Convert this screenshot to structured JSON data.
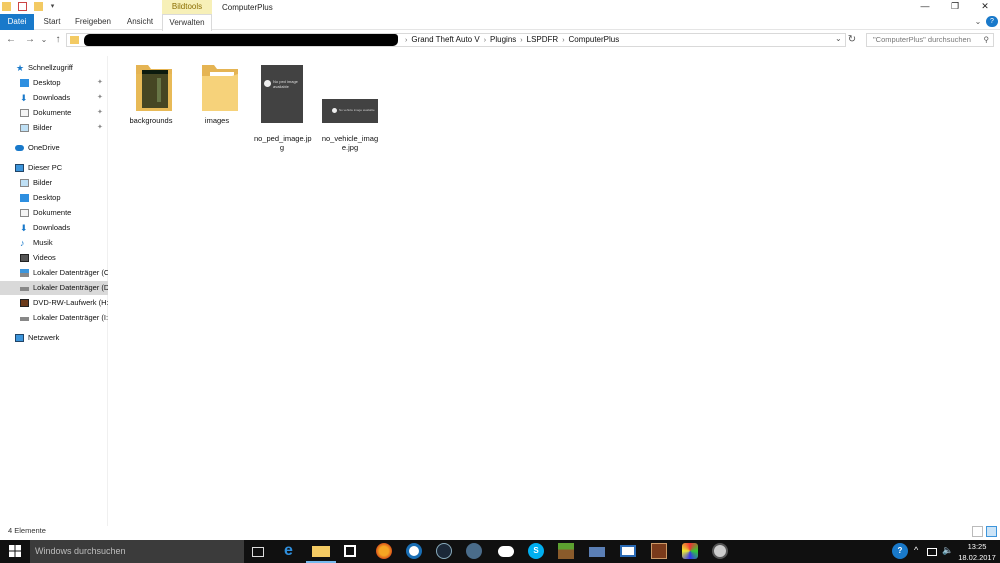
{
  "window": {
    "title": "ComputerPlus",
    "context_group": "Bildtools",
    "controls": {
      "minimize": "—",
      "maximize": "❐",
      "close": "✕"
    }
  },
  "ribbon": {
    "tabs": [
      "Datei",
      "Start",
      "Freigeben",
      "Ansicht",
      "Verwalten"
    ],
    "expand_glyph": "⌄",
    "help_glyph": "?"
  },
  "address": {
    "breadcrumbs": [
      "Grand Theft Auto V",
      "Plugins",
      "LSPDFR",
      "ComputerPlus"
    ],
    "separator": "›",
    "search_placeholder": "\"ComputerPlus\" durchsuchen",
    "nav_glyphs": {
      "back": "←",
      "forward": "→",
      "recent": "⌄",
      "up": "↑",
      "dropdown": "⌄",
      "refresh": "↻",
      "search": "⚲"
    }
  },
  "sidebar": {
    "pin_glyph": "✦",
    "items": [
      {
        "label": "Schnellzugriff",
        "icon": "star-icon"
      },
      {
        "label": "Desktop",
        "icon": "desktop-icon"
      },
      {
        "label": "Downloads",
        "icon": "download-icon"
      },
      {
        "label": "Dokumente",
        "icon": "documents-icon"
      },
      {
        "label": "Bilder",
        "icon": "pictures-icon"
      },
      {
        "label": "OneDrive",
        "icon": "cloud-icon"
      },
      {
        "label": "Dieser PC",
        "icon": "computer-icon"
      },
      {
        "label": "Bilder",
        "icon": "pictures-icon"
      },
      {
        "label": "Desktop",
        "icon": "desktop-icon"
      },
      {
        "label": "Dokumente",
        "icon": "documents-icon"
      },
      {
        "label": "Downloads",
        "icon": "download-icon"
      },
      {
        "label": "Musik",
        "icon": "music-icon"
      },
      {
        "label": "Videos",
        "icon": "video-icon"
      },
      {
        "label": "Lokaler Datenträger (C",
        "icon": "drive-icon"
      },
      {
        "label": "Lokaler Datenträger (D",
        "icon": "drive-icon"
      },
      {
        "label": "DVD-RW-Laufwerk (H:",
        "icon": "dvd-icon"
      },
      {
        "label": "Lokaler Datenträger (I:",
        "icon": "drive-icon"
      },
      {
        "label": "Netzwerk",
        "icon": "network-icon"
      }
    ]
  },
  "files": [
    {
      "name": "backgrounds",
      "type": "folder"
    },
    {
      "name": "images",
      "type": "folder"
    },
    {
      "name": "no_ped_image.jp\ng",
      "type": "image",
      "preview_text": "No ped image\navailable"
    },
    {
      "name": "no_vehicle_imag\ne.jpg",
      "type": "image",
      "preview_text": "No vehicle image available"
    }
  ],
  "status": {
    "count": "4 Elemente"
  },
  "taskbar": {
    "search_placeholder": "Windows durchsuchen",
    "apps": [
      "task-view-icon",
      "edge-icon",
      "file-explorer-icon",
      "store-icon",
      "firefox-icon",
      "teamviewer-icon",
      "steam-icon",
      "app-icon",
      "onedrive-icon",
      "skype-icon",
      "minecraft-icon",
      "network-app-icon",
      "mail-icon",
      "game-icon",
      "game-icon-2",
      "game-icon-3"
    ],
    "help_glyph": "?",
    "tray_glyphs": {
      "chevron": "^",
      "volume": "🔈"
    },
    "time": "13:25",
    "date": "18.02.2017"
  },
  "colors": {
    "accent": "#1979ca",
    "folder": "#f3ca63",
    "selected": "#d9d9d9",
    "taskbar": "#101010"
  }
}
